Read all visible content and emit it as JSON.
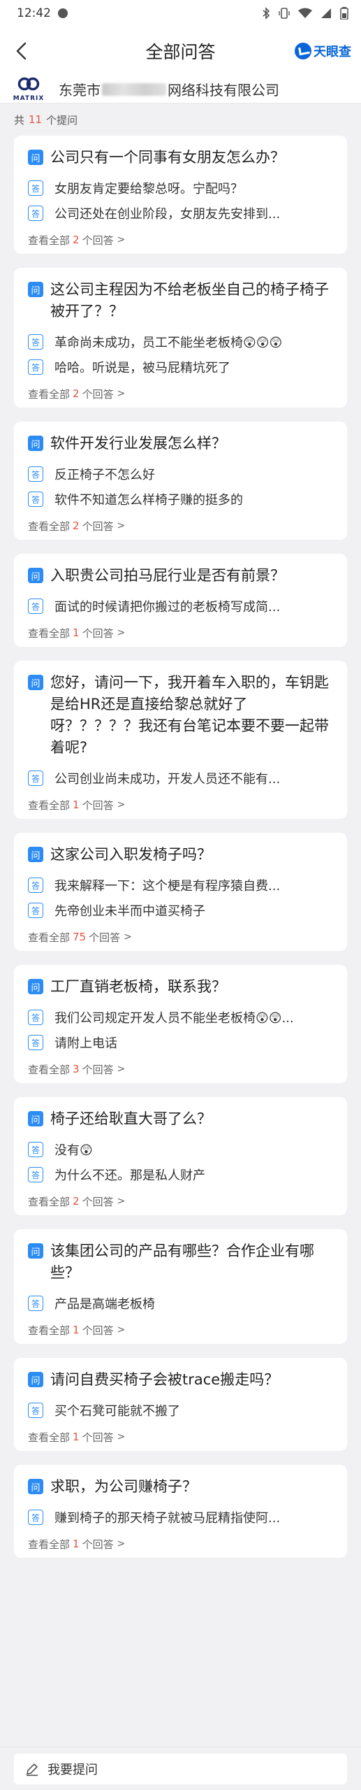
{
  "status": {
    "time": "12:42"
  },
  "nav": {
    "title": "全部问答",
    "brand": "天眼查"
  },
  "company": {
    "logo_word": "MATRIX",
    "name_prefix": "东莞市",
    "name_suffix": "网络科技有限公司"
  },
  "summary": {
    "prefix": "共",
    "count": "11",
    "suffix": "个提问"
  },
  "labels": {
    "question": "问",
    "answer": "答",
    "see_all_prefix": "查看全部",
    "see_all_suffix": "个回答",
    "chevron": ">"
  },
  "questions": [
    {
      "question": "公司只有一个同事有女朋友怎么办？",
      "answers": [
        "女朋友肯定要给黎总呀。宁配吗？",
        "公司还处在创业阶段，女朋友先安排到..."
      ],
      "answer_count": "2"
    },
    {
      "question": "这公司主程因为不给老板坐自己的椅子椅子被开了？？",
      "answers": [
        "革命尚未成功，员工不能坐老板椅😲😲😲",
        "哈哈。听说是，被马屁精坑死了"
      ],
      "answer_count": "2"
    },
    {
      "question": "软件开发行业发展怎么样？",
      "answers": [
        "反正椅子不怎么好",
        "软件不知道怎么样椅子赚的挺多的"
      ],
      "answer_count": "2"
    },
    {
      "question": "入职贵公司拍马屁行业是否有前景？",
      "answers": [
        "面试的时候请把你搬过的老板椅写成简..."
      ],
      "answer_count": "1"
    },
    {
      "question": "您好，请问一下，我开着车入职的，车钥匙是给HR还是直接给黎总就好了呀？？？？？我还有台笔记本要不要一起带着呢?",
      "answers": [
        "公司创业尚未成功，开发人员还不能有..."
      ],
      "answer_count": "1"
    },
    {
      "question": "这家公司入职发椅子吗？",
      "answers": [
        "我来解释一下：这个梗是有程序猿自费...",
        "先帝创业未半而中道买椅子"
      ],
      "answer_count": "75"
    },
    {
      "question": "工厂直销老板椅，联系我？",
      "answers": [
        "我们公司规定开发人员不能坐老板椅😲😲...",
        "请附上电话"
      ],
      "answer_count": "3"
    },
    {
      "question": "椅子还给耿直大哥了么？",
      "answers": [
        "没有😲",
        "为什么不还。那是私人财产"
      ],
      "answer_count": "2"
    },
    {
      "question": "该集团公司的产品有哪些？合作企业有哪些？",
      "answers": [
        "产品是高端老板椅"
      ],
      "answer_count": "1"
    },
    {
      "question": "请问自费买椅子会被trace搬走吗？",
      "answers": [
        "买个石凳可能就不搬了"
      ],
      "answer_count": "1"
    },
    {
      "question": "求职，为公司赚椅子？",
      "answers": [
        "赚到椅子的那天椅子就被马屁精指使阿..."
      ],
      "answer_count": "1"
    }
  ],
  "ask": {
    "placeholder": "我要提问"
  },
  "colors": {
    "accent": "#2c8cf4",
    "highlight": "#e8523f",
    "brand": "#0a66d8"
  }
}
